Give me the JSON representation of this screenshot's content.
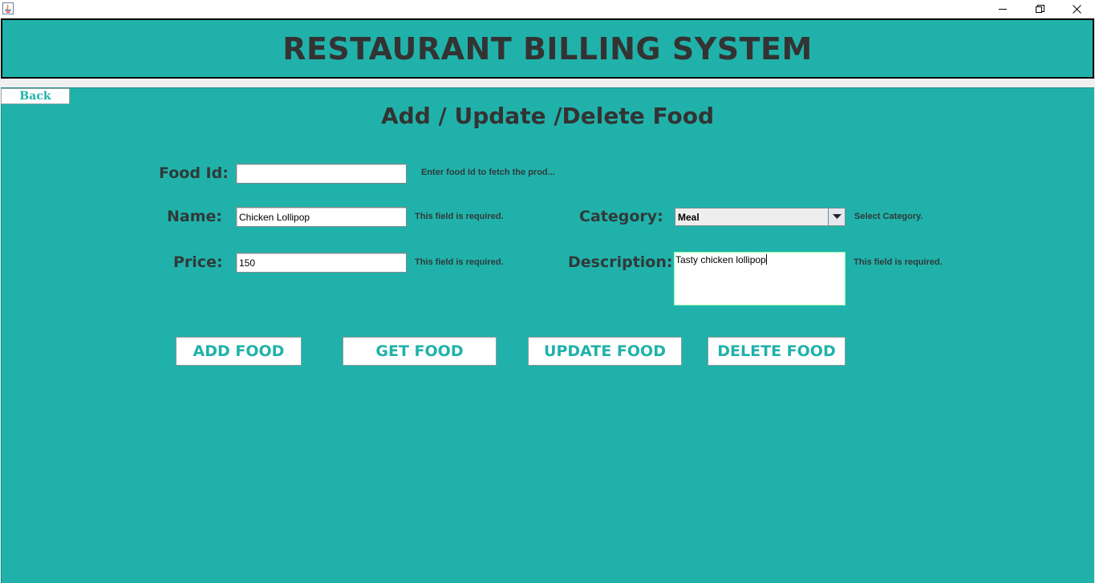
{
  "window": {
    "minimize_icon": "minimize-icon",
    "restore_icon": "restore-icon",
    "close_icon": "close-icon"
  },
  "header": {
    "title": "RESTAURANT BILLING SYSTEM"
  },
  "nav": {
    "back_label": "Back"
  },
  "page": {
    "title": "Add / Update /Delete Food"
  },
  "form": {
    "food_id": {
      "label": "Food Id:",
      "value": "",
      "hint": "Enter food Id to fetch the prod..."
    },
    "name": {
      "label": "Name:",
      "value": "Chicken Lollipop",
      "hint": "This field is required."
    },
    "price": {
      "label": "Price:",
      "value": "150",
      "hint": "This field is required."
    },
    "category": {
      "label": "Category:",
      "selected": "Meal",
      "hint": "Select Category."
    },
    "description": {
      "label": "Description:",
      "value": "Tasty chicken lollipop",
      "hint": "This field is required."
    }
  },
  "actions": {
    "add": "ADD FOOD",
    "get": "GET FOOD",
    "update": "UPDATE FOOD",
    "delete": "DELETE FOOD"
  },
  "colors": {
    "accent": "#20b2aa",
    "text": "#333333"
  }
}
